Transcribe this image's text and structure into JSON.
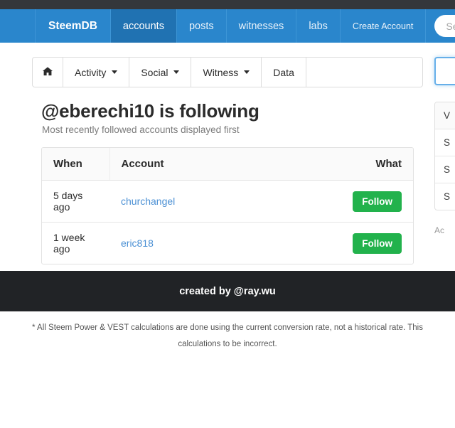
{
  "navbar": {
    "brand": "SteemDB",
    "items": [
      {
        "label": "accounts",
        "active": true
      },
      {
        "label": "posts",
        "active": false
      },
      {
        "label": "witnesses",
        "active": false
      },
      {
        "label": "labs",
        "active": false
      },
      {
        "label": "Create Account",
        "active": false
      }
    ],
    "search_placeholder": "Search a",
    "search_value": "",
    "bg_color": "#2a86cc",
    "active_color": "#2072b2"
  },
  "subnav": {
    "home_icon": "home-icon",
    "items": [
      {
        "label": "Activity",
        "has_caret": true
      },
      {
        "label": "Social",
        "has_caret": true
      },
      {
        "label": "Witness",
        "has_caret": true
      },
      {
        "label": "Data",
        "has_caret": false
      }
    ]
  },
  "header": {
    "title": "@eberechi10 is following",
    "subtitle": "Most recently followed accounts displayed first"
  },
  "table": {
    "columns": [
      "When",
      "Account",
      "What"
    ],
    "rows": [
      {
        "when": "5 days ago",
        "account": "churchangel",
        "action": "Follow"
      },
      {
        "when": "1 week ago",
        "account": "eric818",
        "action": "Follow"
      }
    ],
    "button_color": "#22b24c",
    "link_color": "#4b90d4"
  },
  "sidebar": {
    "input_value": "",
    "list_items": [
      "V",
      "S",
      "S",
      "S"
    ],
    "note": "Ac"
  },
  "footer": {
    "note_line1": "* All Steem Power & VEST calculations are done using the current conversion rate, not a historical rate. This",
    "note_line2": "calculations to be incorrect.",
    "credit": "created by @ray.wu",
    "bar_color": "#212326"
  }
}
